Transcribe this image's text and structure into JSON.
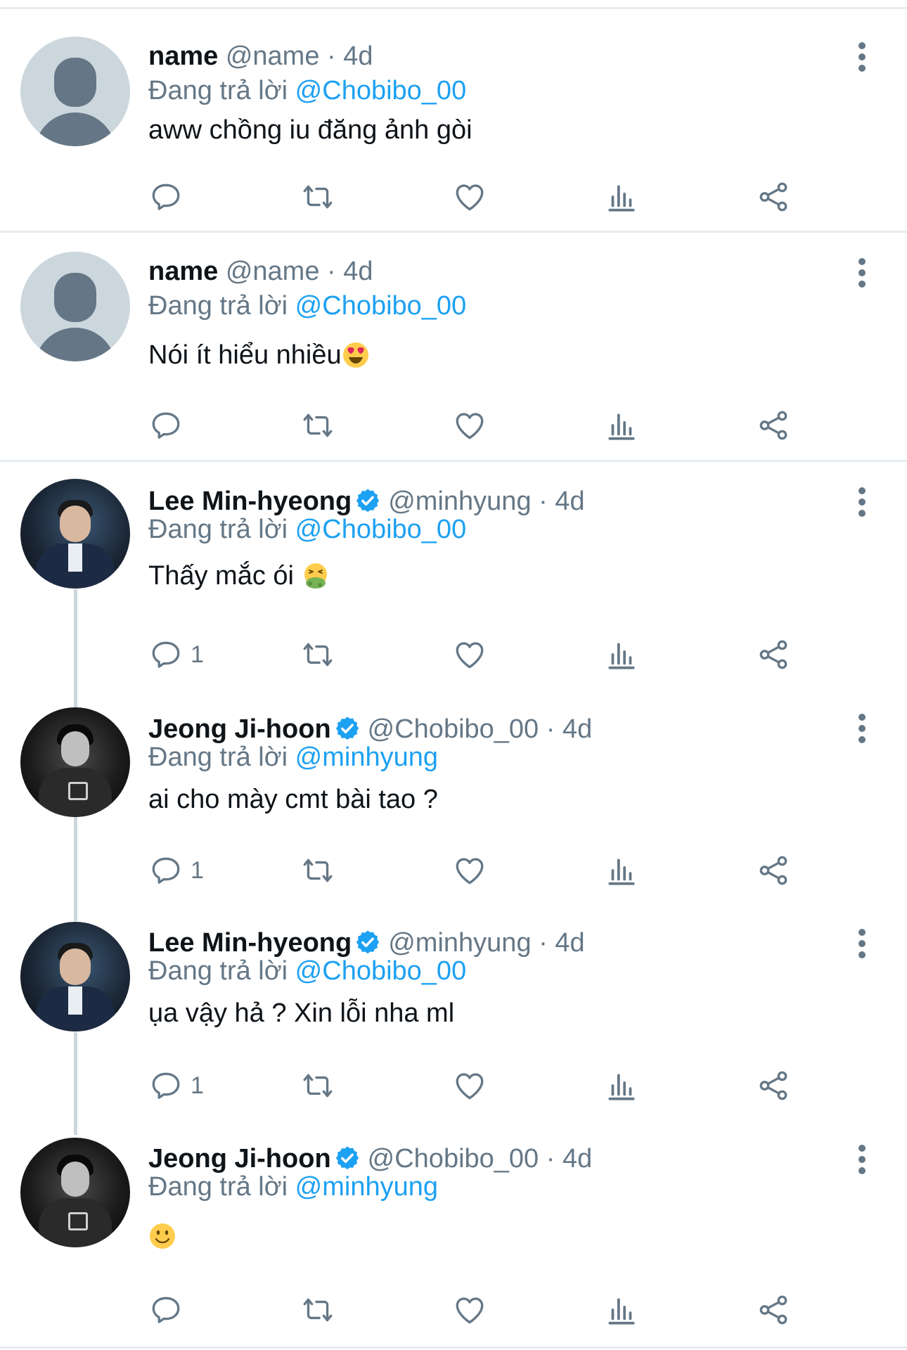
{
  "reply_prefix": "Đang trả lời",
  "colors": {
    "accent": "#1da1f2",
    "muted": "#657786",
    "text": "#0f1419",
    "divider": "#e6ecf0"
  },
  "tweets": [
    {
      "name": "name",
      "handle": "@name",
      "sep": "·",
      "time": "4d",
      "reply_to": "@Chobibo_00",
      "text": "aww chồng iu đăng ảnh gòi",
      "reply_count": "",
      "avatar": "default-avatar"
    },
    {
      "name": "name",
      "handle": "@name",
      "sep": "·",
      "time": "4d",
      "reply_to": "@Chobibo_00",
      "text": "Nói ít hiểu nhiều",
      "emoji": "heart-eyes-emoji",
      "reply_count": "",
      "avatar": "default-avatar"
    },
    {
      "name": "Lee Min-hyeong",
      "handle": "@minhyung",
      "sep": "·",
      "time": "4d",
      "verified": true,
      "reply_to": "@Chobibo_00",
      "text": "Thấy mắc ói",
      "emoji": "vomiting-face-emoji",
      "reply_count": "1",
      "avatar": "photo-avatar"
    },
    {
      "name": "Jeong Ji-hoon",
      "handle": "@Chobibo_00",
      "sep": "·",
      "time": "4d",
      "verified": true,
      "reply_to": "@minhyung",
      "text": "ai cho mày cmt bài tao ?",
      "reply_count": "1",
      "avatar": "photo-avatar"
    },
    {
      "name": "Lee Min-hyeong",
      "handle": "@minhyung",
      "sep": "·",
      "time": "4d",
      "verified": true,
      "reply_to": "@Chobibo_00",
      "text": "ụa vậy hả ? Xin lỗi nha ml",
      "reply_count": "1",
      "avatar": "photo-avatar"
    },
    {
      "name": "Jeong Ji-hoon",
      "handle": "@Chobibo_00",
      "sep": "·",
      "time": "4d",
      "verified": true,
      "reply_to": "@minhyung",
      "text": "",
      "emoji": "slightly-smiling-face-emoji",
      "reply_count": "",
      "avatar": "photo-avatar"
    }
  ],
  "icons": {
    "reply": "reply-icon",
    "retweet": "retweet-icon",
    "like": "heart-icon",
    "analytics": "analytics-icon",
    "share": "share-icon",
    "more": "more-options-icon",
    "verified": "verified-badge-icon"
  }
}
